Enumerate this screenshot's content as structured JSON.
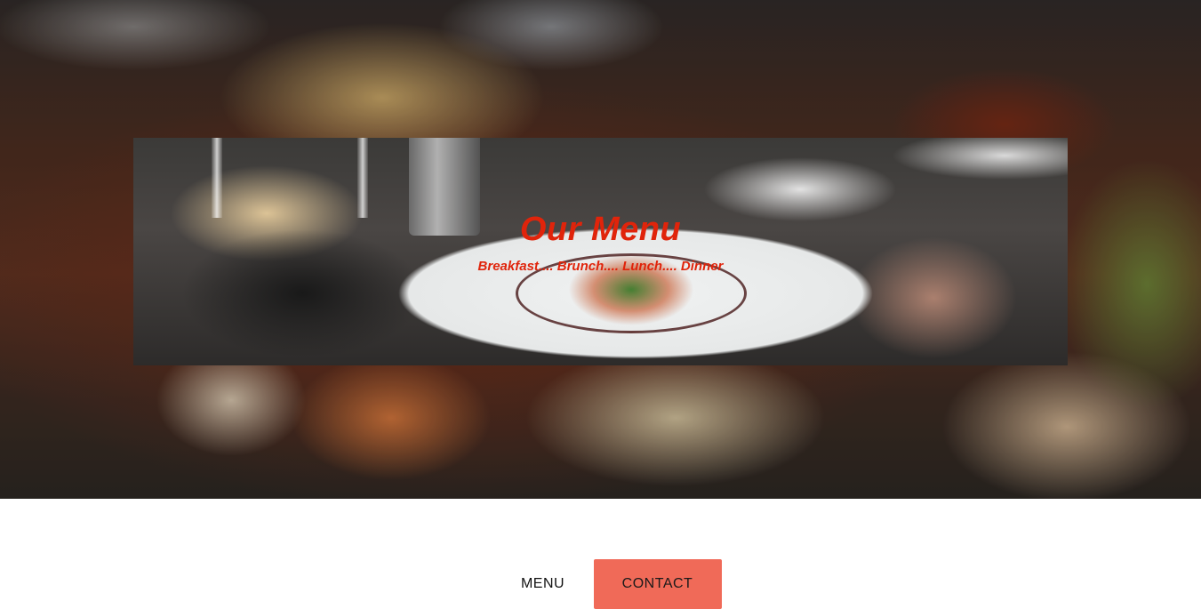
{
  "banner": {
    "title": "Our Menu",
    "subtitle": "Breakfast.... Brunch.... Lunch.... Dinner"
  },
  "nav": {
    "items": [
      {
        "label": "MENU"
      },
      {
        "label": "CONTACT"
      }
    ]
  },
  "colors": {
    "title_red": "#e0240b",
    "contact_bg": "#f06a58"
  }
}
